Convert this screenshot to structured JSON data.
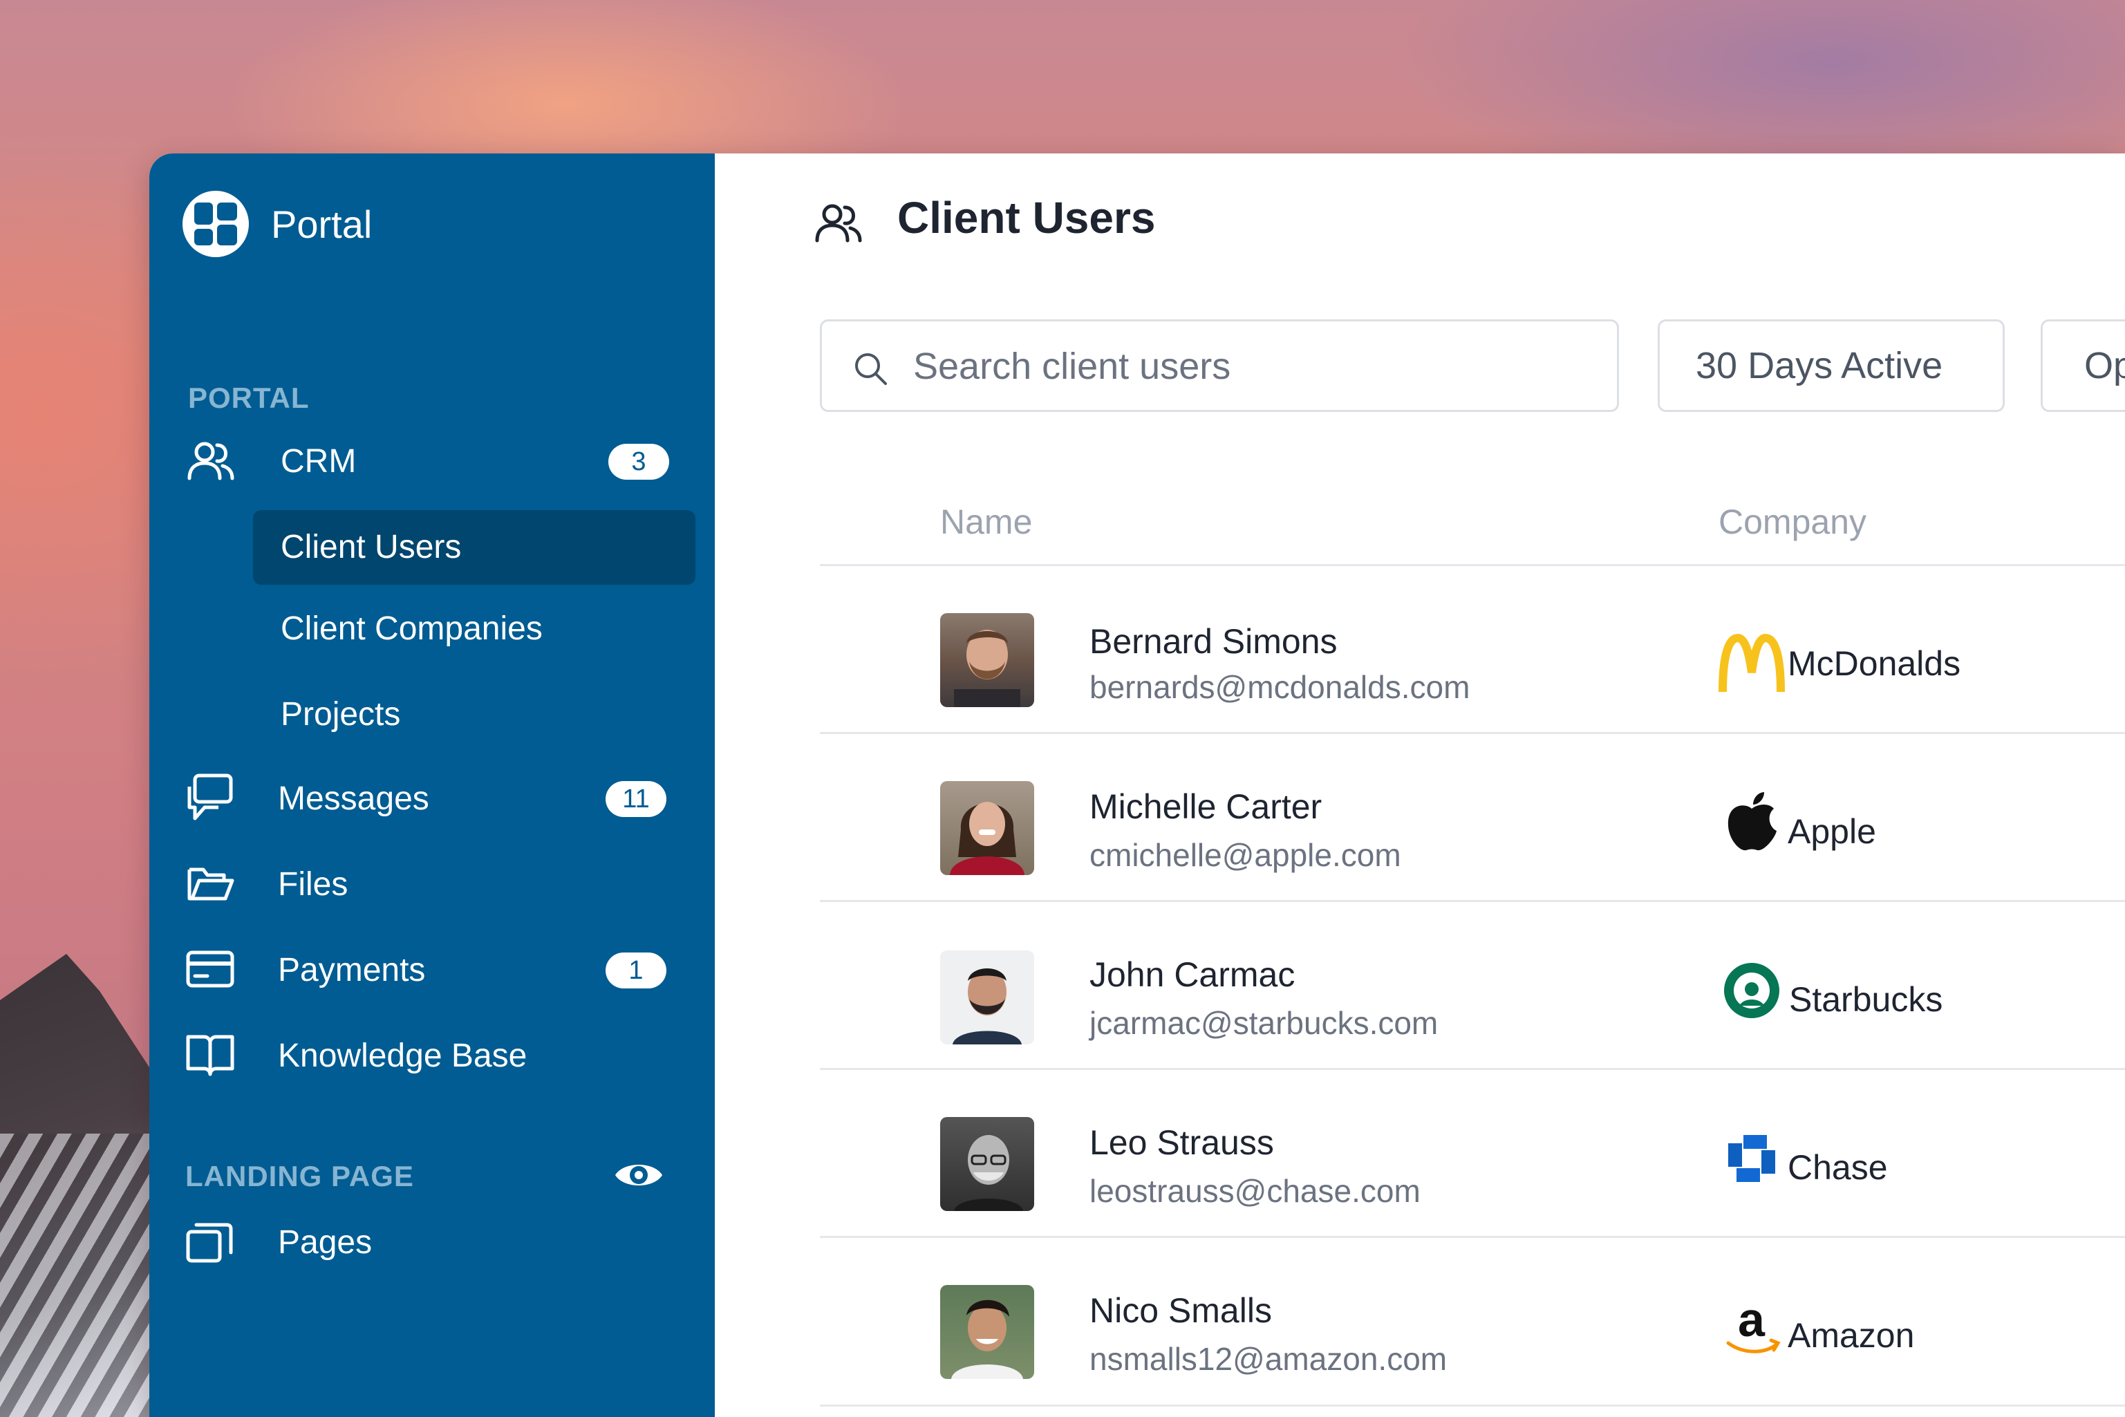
{
  "app": {
    "brand": "Portal"
  },
  "sidebar": {
    "portal_section": "PORTAL",
    "items": [
      {
        "label": "CRM",
        "icon": "users-icon",
        "badge": "3"
      },
      {
        "label": "Messages",
        "icon": "messages-icon",
        "badge": "11"
      },
      {
        "label": "Files",
        "icon": "folder-icon"
      },
      {
        "label": "Payments",
        "icon": "credit-card-icon",
        "badge": "1"
      },
      {
        "label": "Knowledge Base",
        "icon": "book-icon"
      }
    ],
    "crm_sub": [
      {
        "label": "Client Users",
        "active": true
      },
      {
        "label": "Client Companies"
      },
      {
        "label": "Projects"
      }
    ],
    "landing_section": "LANDING PAGE",
    "landing_items": [
      {
        "label": "Pages",
        "icon": "pages-icon"
      }
    ]
  },
  "main": {
    "title": "Client Users",
    "search": {
      "placeholder": "Search client users"
    },
    "filters": [
      "30 Days Active",
      "Op"
    ],
    "table": {
      "columns": [
        "Name",
        "Company"
      ],
      "rows": [
        {
          "name": "Bernard Simons",
          "email": "bernards@mcdonalds.com",
          "company": "McDonalds",
          "logo": "mcdonalds-logo"
        },
        {
          "name": "Michelle Carter",
          "email": "cmichelle@apple.com",
          "company": "Apple",
          "logo": "apple-logo"
        },
        {
          "name": "John Carmac",
          "email": "jcarmac@starbucks.com",
          "company": "Starbucks",
          "logo": "starbucks-logo"
        },
        {
          "name": "Leo Strauss",
          "email": "leostrauss@chase.com",
          "company": "Chase",
          "logo": "chase-logo"
        },
        {
          "name": "Nico Smalls",
          "email": "nsmalls12@amazon.com",
          "company": "Amazon",
          "logo": "amazon-logo"
        }
      ]
    }
  },
  "colors": {
    "sidebar": "#005c92",
    "active_item": "#00466f",
    "section_label": "#87b5d2"
  }
}
